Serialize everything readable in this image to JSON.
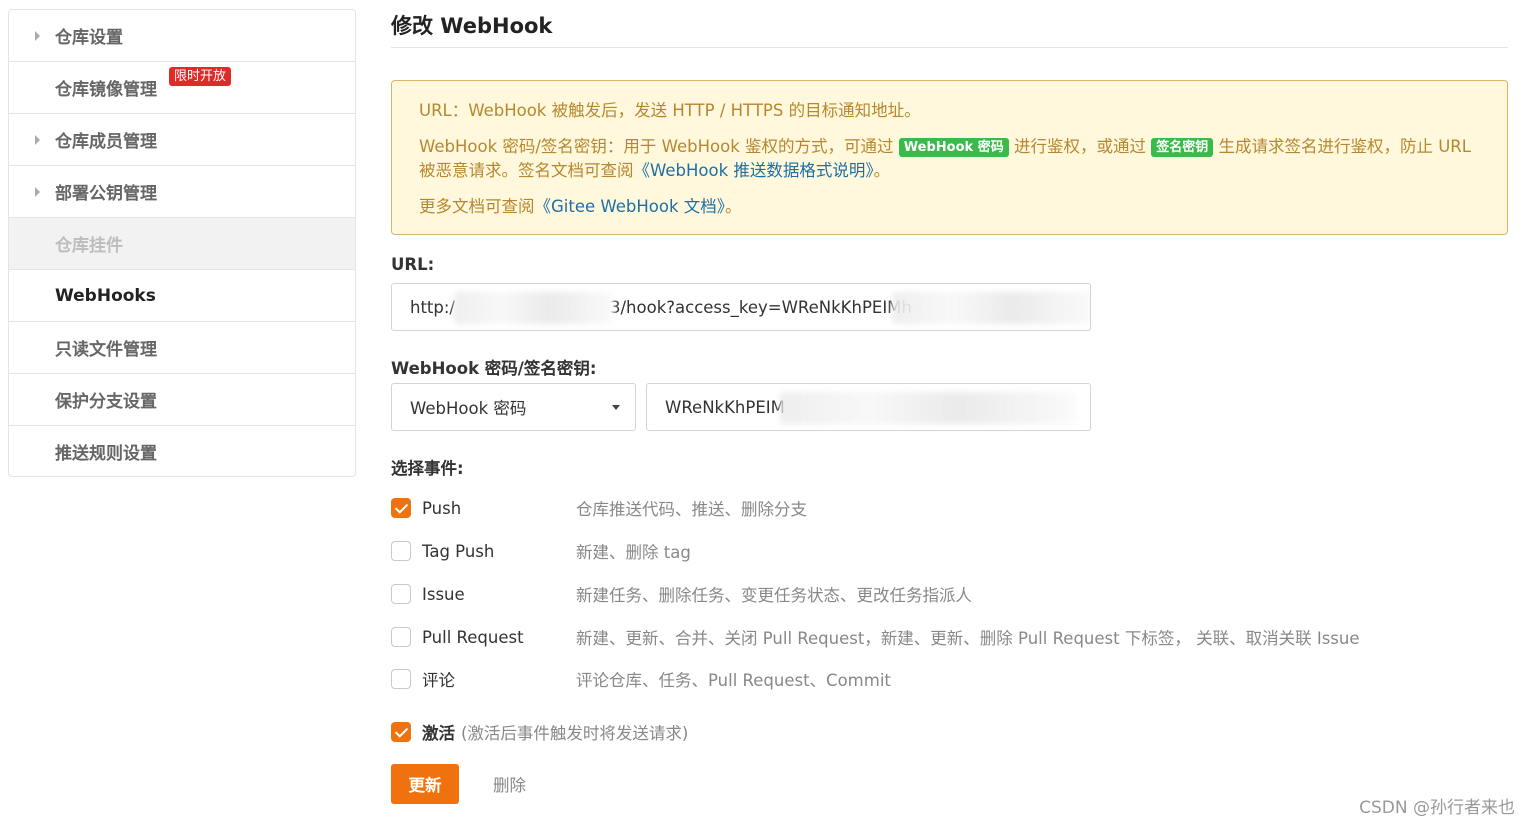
{
  "sidebar": {
    "items": [
      {
        "label": "仓库设置",
        "caret": true,
        "state": "normal"
      },
      {
        "label": "仓库镜像管理",
        "caret": false,
        "state": "normal",
        "badge": "限时开放"
      },
      {
        "label": "仓库成员管理",
        "caret": true,
        "state": "normal"
      },
      {
        "label": "部署公钥管理",
        "caret": true,
        "state": "normal"
      },
      {
        "label": "仓库挂件",
        "caret": false,
        "state": "disabled"
      },
      {
        "label": "WebHooks",
        "caret": false,
        "state": "active"
      },
      {
        "label": "只读文件管理",
        "caret": false,
        "state": "normal"
      },
      {
        "label": "保护分支设置",
        "caret": false,
        "state": "normal"
      },
      {
        "label": "推送规则设置",
        "caret": false,
        "state": "normal"
      }
    ]
  },
  "page": {
    "title": "修改 WebHook"
  },
  "notice": {
    "line1": "URL：WebHook 被触发后，发送 HTTP / HTTPS 的目标通知地址。",
    "line2_a": "WebHook 密码/签名密钥：用于 WebHook 鉴权的方式，可通过",
    "line2_tag1": "WebHook 密码",
    "line2_b": "进行鉴权，或通过",
    "line2_tag2": "签名密钥",
    "line2_c": "生成请求签名进行鉴权，防止 URL 被恶意请求。签名文档可查阅",
    "line2_link": "《WebHook 推送数据格式说明》",
    "line2_d": "。",
    "line3_a": "更多文档可查阅",
    "line3_link": "《Gitee WebHook 文档》",
    "line3_b": "。"
  },
  "url_field": {
    "label": "URL:",
    "value_prefix": "http:/",
    "value_visible": "3/hook?access_key=WReNkKhPEIMh"
  },
  "secret_field": {
    "label": "WebHook 密码/签名密钥:",
    "type_selected": "WebHook 密码",
    "value_visible": "WReNkKhPEIM"
  },
  "events": {
    "label": "选择事件:",
    "items": [
      {
        "name": "Push",
        "desc": "仓库推送代码、推送、删除分支",
        "checked": true
      },
      {
        "name": "Tag Push",
        "desc": "新建、删除 tag",
        "checked": false
      },
      {
        "name": "Issue",
        "desc": "新建任务、删除任务、变更任务状态、更改任务指派人",
        "checked": false
      },
      {
        "name": "Pull Request",
        "desc": "新建、更新、合并、关闭 Pull Request，新建、更新、删除 Pull Request 下标签， 关联、取消关联 Issue",
        "checked": false
      },
      {
        "name": "评论",
        "desc": "评论仓库、任务、Pull Request、Commit",
        "checked": false
      }
    ]
  },
  "activate": {
    "label": "激活",
    "hint": "(激活后事件触发时将发送请求)",
    "checked": true
  },
  "actions": {
    "update_label": "更新",
    "delete_label": "删除"
  },
  "watermark": "CSDN @孙行者来也",
  "colors": {
    "accent": "#f0720e",
    "badge": "#e02a2a",
    "tag_green": "#3cb94a",
    "notice_bg": "#fff8dc",
    "notice_text": "#b5882f",
    "link": "#1d6fa5"
  }
}
